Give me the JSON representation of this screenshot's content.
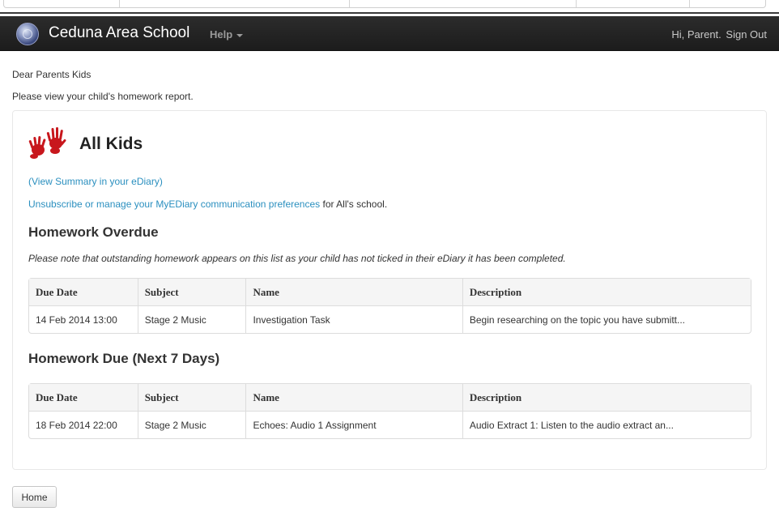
{
  "navbar": {
    "brand": "Ceduna Area School",
    "help": "Help",
    "greeting": "Hi, Parent.",
    "signout": "Sign Out"
  },
  "intro": {
    "greeting": "Dear Parents Kids",
    "instruction": "Please view your child's homework report."
  },
  "student": {
    "name": "All Kids",
    "summary_link": "(View Summary in your eDiary)",
    "unsubscribe_link": "Unsubscribe or manage your MyEDiary communication preferences",
    "unsubscribe_suffix": " for All's school."
  },
  "overdue": {
    "title": "Homework Overdue",
    "note": "Please note that outstanding homework appears on this list as your child has not ticked in their eDiary it has been completed.",
    "columns": [
      "Due Date",
      "Subject",
      "Name",
      "Description"
    ],
    "rows": [
      [
        "14 Feb 2014 13:00",
        "Stage 2 Music",
        "Investigation Task",
        "Begin researching on the topic you have submitt..."
      ]
    ]
  },
  "upcoming": {
    "title": "Homework Due (Next 7 Days)",
    "columns": [
      "Due Date",
      "Subject",
      "Name",
      "Description"
    ],
    "rows": [
      [
        "18 Feb 2014 22:00",
        "Stage 2 Music",
        "Echoes: Audio 1 Assignment",
        "Audio Extract 1: Listen to the audio extract an..."
      ]
    ]
  },
  "footer": {
    "home_button": "Home"
  },
  "colors": {
    "navbar_bg": "#222222",
    "link": "#2a8fbf",
    "handprint": "#c8171d"
  },
  "icons": {
    "brand_logo": "school-crest-icon",
    "student_logo": "handprints-icon",
    "help_menu": "caret-down-icon"
  }
}
